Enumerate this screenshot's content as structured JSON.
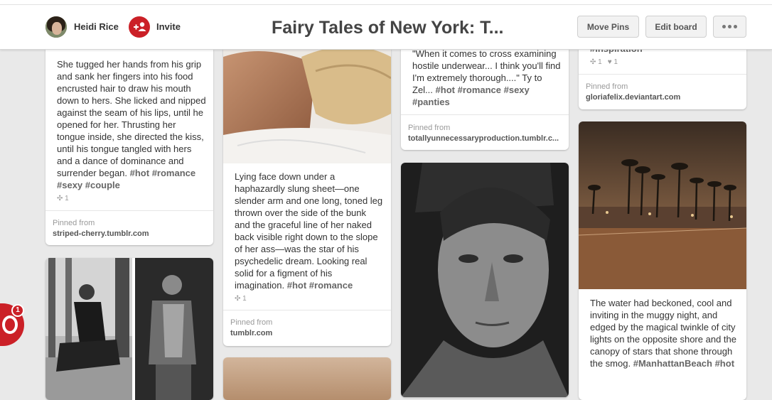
{
  "header": {
    "owner_name": "Heidi Rice",
    "invite_label": "Invite",
    "board_title": "Fairy Tales of New York: T...",
    "move_pins_label": "Move Pins",
    "edit_board_label": "Edit board",
    "brand_color": "#cb2027"
  },
  "pins": {
    "pin1": {
      "description": "She tugged her hands from his grip and sank her fingers into his food encrusted hair to draw his mouth down to hers. She licked and nipped against the seam of his lips, until he opened for her. Thrusting her tongue inside, she directed the kiss, until his tongue tangled with hers and a dance of dominance and surrender began.",
      "tags": "#hot #romance #sexy #couple",
      "repins": "1",
      "pinned_from_label": "Pinned from",
      "source": "striped-cherry.tumblr.com"
    },
    "pin2": {
      "description": "Lying face down under a haphazardly slung sheet—one slender arm and one long, toned leg thrown over the side of the bunk and the graceful line of her naked back visible right down to the slope of her ass—was the star of his psychedelic dream. Looking real solid for a figment of his imagination.",
      "tags": "#hot #romance",
      "repins": "1",
      "pinned_from_label": "Pinned from",
      "source": "tumblr.com"
    },
    "pin3": {
      "description": "\"When it comes to cross examining hostile underwear... I think you'll find I'm extremely thorough....\" Ty to Zel...",
      "tags": "#hot #romance #sexy #panties",
      "pinned_from_label": "Pinned from",
      "source": "totallyunnecessaryproduction.tumblr.c..."
    },
    "pin4": {
      "tags": "#inspiration",
      "repins": "1",
      "likes": "1",
      "pinned_from_label": "Pinned from",
      "source": "gloriafelix.deviantart.com"
    },
    "pin5": {
      "description": "The water had beckoned, cool and inviting in the muggy night, and edged by the magical twinkle of city lights on the opposite shore and the canopy of stars that shone through the smog.",
      "tags": "#ManhattanBeach #hot"
    }
  },
  "notification": {
    "count": "1"
  }
}
